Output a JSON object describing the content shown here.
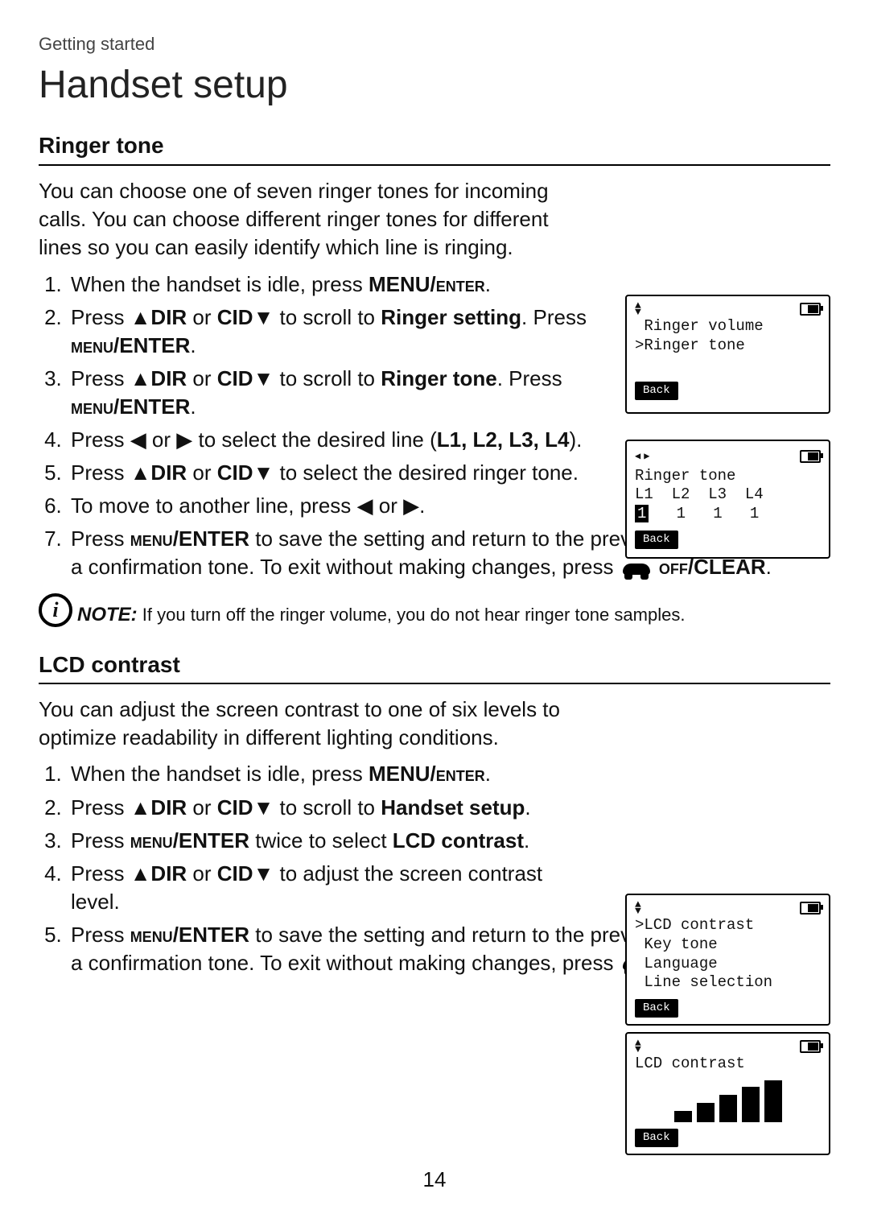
{
  "breadcrumb": "Getting started",
  "page_title": "Handset setup",
  "page_number": "14",
  "icons": {
    "up": "▲",
    "down": "▼",
    "left": "◀",
    "right": "▶"
  },
  "ringer": {
    "heading": "Ringer tone",
    "intro": "You can choose one of seven ringer tones for incoming calls. You can choose different ringer tones for different lines so you can easily identify which line is ringing.",
    "steps": {
      "s1_a": "When the handset is idle, press ",
      "s1_b": "MENU/",
      "s1_c": "enter",
      "s1_d": ".",
      "s2_a": "Press ",
      "s2_dir": "DIR",
      "s2_b": " or ",
      "s2_cid": "CID",
      "s2_c": " to scroll to ",
      "s2_target": "Ringer setting",
      "s2_d": ". Press ",
      "s2_menu": "menu",
      "s2_enter": "/ENTER",
      "s2_e": ".",
      "s3_c": " to scroll to ",
      "s3_target": "Ringer tone",
      "s4_a": "Press  ",
      "s4_b": " or ",
      "s4_c": "  to select the desired line (",
      "s4_lines": "L1, L2, L3, L4",
      "s4_paren": ").",
      "s5_c": " to select the desired ringer tone.",
      "s6_a": "To move to another line, press  ",
      "s6_b": " or ",
      "s6_c": ".",
      "s7_a": "Press ",
      "s7_b": " to save the setting and return to the previous menu. There is a confirmation tone. To exit without making changes, press ",
      "s7_off": " off",
      "s7_clear": "/CLEAR",
      "s7_c": "."
    },
    "note_label": "NOTE:",
    "note_text": " If you turn off the ringer volume, you do not hear ringer tone samples."
  },
  "lcd": {
    "heading": "LCD contrast",
    "intro": "You can adjust the screen contrast to one of six levels to optimize readability in different lighting conditions.",
    "steps": {
      "s2_c": " to scroll to ",
      "s2_target": "Handset setup",
      "s2_d": ".",
      "s3_a": "Press ",
      "s3_b": " twice to select ",
      "s3_target": "LCD contrast",
      "s3_c": ".",
      "s4_c": " to adjust the screen contrast level.",
      "s5_b": " to save the setting and return to the previous menu. There is a confirmation tone. To exit without making changes, press "
    }
  },
  "screens": {
    "s1": {
      "l1": " Ringer volume",
      "l2": ">Ringer tone",
      "softkey": "Back"
    },
    "s2": {
      "title": "Ringer tone",
      "header": "L1  L2  L3  L4",
      "sel": "1",
      "rest": "   1   1   1",
      "softkey": "Back"
    },
    "s3": {
      "l1": ">LCD contrast",
      "l2": " Key tone",
      "l3": " Language",
      "l4": " Line selection",
      "softkey": "Back"
    },
    "s4": {
      "title": "LCD contrast",
      "softkey": "Back"
    }
  }
}
